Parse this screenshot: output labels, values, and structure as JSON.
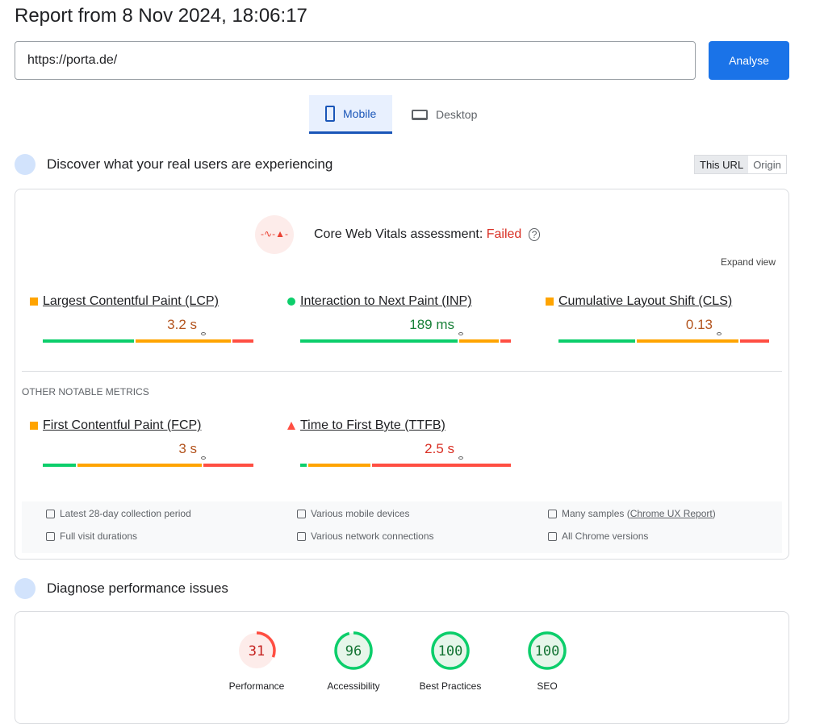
{
  "title": "Report from 8 Nov 2024, 18:06:17",
  "url_input": "https://porta.de/",
  "analyse_label": "Analyse",
  "tabs": [
    {
      "label": "Mobile",
      "active": true
    },
    {
      "label": "Desktop",
      "active": false
    }
  ],
  "field": {
    "heading": "Discover what your real users are experiencing",
    "toggle": [
      "This URL",
      "Origin"
    ],
    "assessment_label": "Core Web Vitals assessment:",
    "assessment_result": "Failed",
    "expand": "Expand view",
    "other_label": "OTHER NOTABLE METRICS",
    "metrics": [
      {
        "name": "Largest Contentful Paint (LCP)",
        "value": "3.2 s",
        "rating": "orange",
        "dist": [
          44,
          46,
          10
        ],
        "marker": 75
      },
      {
        "name": "Interaction to Next Paint (INP)",
        "value": "189 ms",
        "rating": "green",
        "dist": [
          76,
          19,
          5
        ],
        "marker": 75
      },
      {
        "name": "Cumulative Layout Shift (CLS)",
        "value": "0.13",
        "rating": "orange",
        "dist": [
          37,
          49,
          14
        ],
        "marker": 75
      },
      {
        "name": "First Contentful Paint (FCP)",
        "value": "3 s",
        "rating": "orange",
        "dist": [
          16,
          60,
          24
        ],
        "marker": 75
      },
      {
        "name": "Time to First Byte (TTFB)",
        "value": "2.5 s",
        "rating": "red",
        "dist": [
          3,
          30,
          67
        ],
        "marker": 75
      }
    ],
    "info": [
      {
        "icon": "calendar-icon",
        "text": "Latest 28-day collection period"
      },
      {
        "icon": "devices-icon",
        "text": "Various mobile devices"
      },
      {
        "icon": "samples-icon",
        "text": "Many samples (",
        "link": "Chrome UX Report",
        "after": ")"
      },
      {
        "icon": "timer-icon",
        "text": "Full visit durations"
      },
      {
        "icon": "network-icon",
        "text": "Various network connections"
      },
      {
        "icon": "chrome-icon",
        "text": "All Chrome versions"
      }
    ]
  },
  "diagnose": {
    "heading": "Diagnose performance issues",
    "scores": [
      {
        "label": "Performance",
        "score": "31",
        "value": 31,
        "color": "#ff4e42"
      },
      {
        "label": "Accessibility",
        "score": "96",
        "value": 96,
        "color": "#0cce6b"
      },
      {
        "label": "Best Practices",
        "score": "100",
        "value": 100,
        "color": "#0cce6b"
      },
      {
        "label": "SEO",
        "score": "100",
        "value": 100,
        "color": "#0cce6b"
      }
    ]
  },
  "colors": {
    "green": "#0cce6b",
    "orange": "#ffa400",
    "red": "#ff4e42",
    "blue": "#1a73e8"
  }
}
